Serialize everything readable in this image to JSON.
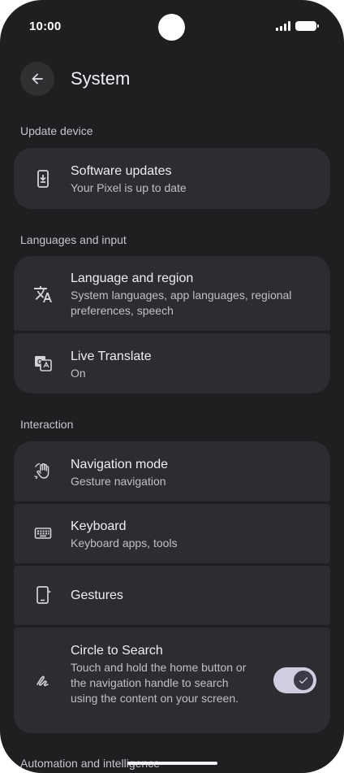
{
  "status": {
    "time": "10:00"
  },
  "header": {
    "title": "System"
  },
  "sections": {
    "update": "Update device",
    "languages": "Languages and input",
    "interaction": "Interaction",
    "automation": "Automation and intelligence"
  },
  "items": {
    "software": {
      "title": "Software updates",
      "subtitle": "Your Pixel is up to date",
      "icon": "system-update-icon"
    },
    "language": {
      "title": "Language and region",
      "subtitle": "System languages, app languages, regional preferences, speech",
      "icon": "translate-icon"
    },
    "live_translate": {
      "title": "Live Translate",
      "subtitle": "On",
      "icon": "live-translate-icon"
    },
    "navigation": {
      "title": "Navigation mode",
      "subtitle": "Gesture navigation",
      "icon": "gesture-hand-icon"
    },
    "keyboard": {
      "title": "Keyboard",
      "subtitle": "Keyboard apps, tools",
      "icon": "keyboard-icon"
    },
    "gestures": {
      "title": "Gestures",
      "icon": "phone-gesture-icon"
    },
    "circle_search": {
      "title": "Circle to Search",
      "subtitle": "Touch and hold the home button or the navigation handle to search using the content on your screen.",
      "icon": "circle-search-icon",
      "enabled": true
    }
  },
  "colors": {
    "background": "#1f1f21",
    "card": "#2d2c30",
    "toggle_track": "#d1cde0"
  }
}
